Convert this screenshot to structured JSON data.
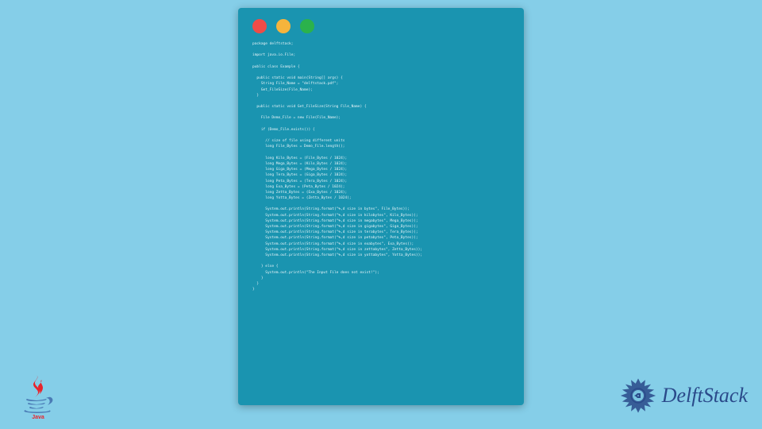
{
  "code": {
    "lines": [
      "package delftstack;",
      "",
      "import java.io.File;",
      "",
      "public class Example {",
      "",
      "  public static void main(String[] args) {",
      "    String File_Name = \"delftstack.pdf\";",
      "    Get_FileSize(File_Name);",
      "  }",
      "",
      "  public static void Get_FileSize(String File_Name) {",
      "",
      "    File Demo_File = new File(File_Name);",
      "",
      "    if (Demo_File.exists()) {",
      "",
      "      // size of file using different units",
      "      long File_Bytes = Demo_File.length();",
      "",
      "      long Kilo_Bytes = (File_Bytes / 1024);",
      "      long Mega_Bytes = (Kilo_Bytes / 1024);",
      "      long Giga_Bytes = (Mega_Bytes / 1024);",
      "      long Tera_Bytes = (Giga_Bytes / 1024);",
      "      long Peta_Bytes = (Tera_Bytes / 1024);",
      "      long Exa_Bytes = (Peta_Bytes / 1024);",
      "      long Zetta_Bytes = (Exa_Bytes / 1024);",
      "      long Yotta_Bytes = (Zetta_Bytes / 1024);",
      "",
      "      System.out.println(String.format(\"%,d size in bytes\", File_Bytes));",
      "      System.out.println(String.format(\"%,d size in kilobytes\", Kilo_Bytes));",
      "      System.out.println(String.format(\"%,d size in megabytes\", Mega_Bytes));",
      "      System.out.println(String.format(\"%,d size in gigabytes\", Giga_Bytes));",
      "      System.out.println(String.format(\"%,d size in terabytes\", Tera_Bytes));",
      "      System.out.println(String.format(\"%,d size in petabytes\", Peta_Bytes));",
      "      System.out.println(String.format(\"%,d size in exabytes\", Exa_Bytes));",
      "      System.out.println(String.format(\"%,d size in zettabytes\", Zetta_Bytes));",
      "      System.out.println(String.format(\"%,d size in yottabytes\", Yotta_Bytes));",
      "",
      "    } else {",
      "      System.out.println(\"The Input File does not exist!\");",
      "    }",
      "  }",
      "}"
    ]
  },
  "branding": {
    "delft_label": "DelftStack"
  }
}
